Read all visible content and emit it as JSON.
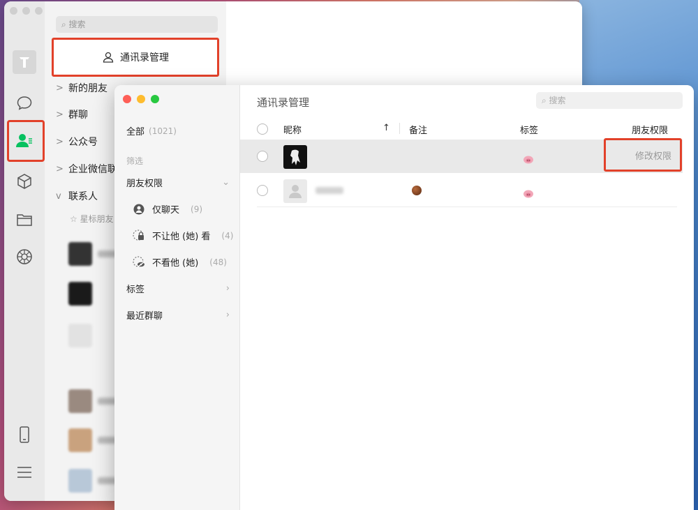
{
  "back_window": {
    "search_placeholder": "搜索",
    "manage_button": "通讯录管理",
    "nav": [
      {
        "label": "新的朋友",
        "chevron": ">"
      },
      {
        "label": "群聊",
        "chevron": ">"
      },
      {
        "label": "公众号",
        "chevron": ">"
      },
      {
        "label": "企业微信联",
        "chevron": ">"
      },
      {
        "label": "联系人",
        "chevron": "v"
      }
    ],
    "starred_label": "☆ 星标朋友"
  },
  "front_window": {
    "sidebar": {
      "all_label": "全部",
      "all_count": "(1021)",
      "filter_label": "筛选",
      "friend_perm_label": "朋友权限",
      "perm_items": [
        {
          "label": "仅聊天",
          "count": "(9)",
          "icon": "chat-only-icon"
        },
        {
          "label": "不让他 (她) 看",
          "count": "(4)",
          "icon": "lock-icon"
        },
        {
          "label": "不看他 (她)",
          "count": "(48)",
          "icon": "eye-hidden-icon"
        }
      ],
      "tags_label": "标签",
      "recent_groups_label": "最近群聊"
    },
    "main": {
      "title": "通讯录管理",
      "search_placeholder": "搜索",
      "columns": {
        "nickname": "昵称",
        "sort_arrow": "↑",
        "remark": "备注",
        "tag": "标签",
        "permission": "朋友权限"
      },
      "row_action": "修改权限"
    }
  },
  "colors": {
    "highlight_red": "#e2412a",
    "wechat_green": "#07c160"
  }
}
